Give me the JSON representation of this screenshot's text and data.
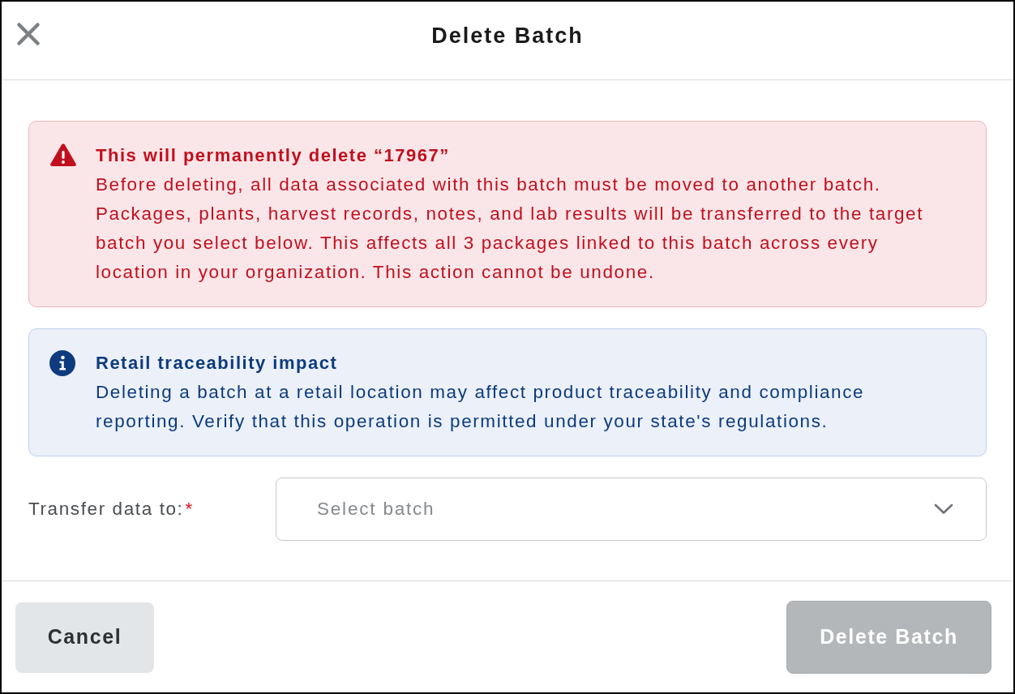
{
  "dialog": {
    "title": "Delete Batch"
  },
  "alerts": [
    {
      "kind": "error",
      "title": "This will permanently delete “17967”",
      "message": "Before deleting, all data associated with this batch must be moved to another batch. Packages, plants, harvest records, notes, and lab results will be transferred to the target batch you select below. This affects all 3 packages linked to this batch across every location in your organization. This action cannot be undone."
    },
    {
      "kind": "info",
      "title": "Retail traceability impact",
      "message": "Deleting a batch at a retail location may affect product traceability and compliance reporting. Verify that this operation is permitted under your state's regulations."
    }
  ],
  "transfer_field": {
    "label": "Transfer data to:",
    "required_mark": "*",
    "placeholder": "Select batch"
  },
  "buttons": [
    {
      "label": "Cancel",
      "kind": "secondary",
      "disabled": false
    },
    {
      "label": "Delete Batch",
      "kind": "danger",
      "disabled": true
    }
  ]
}
